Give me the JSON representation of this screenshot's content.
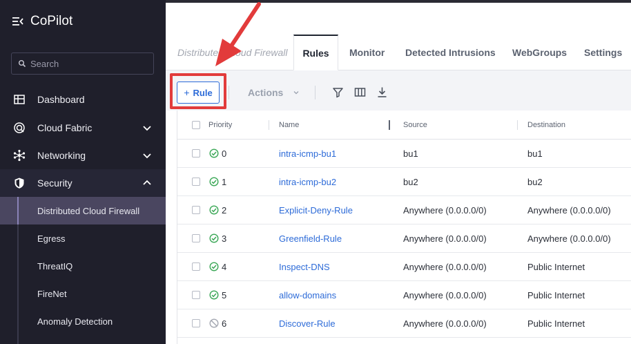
{
  "sidebar": {
    "brand": "CoPilot",
    "search_placeholder": "Search",
    "items": [
      {
        "label": "Dashboard",
        "icon": "dashboard-icon"
      },
      {
        "label": "Cloud Fabric",
        "icon": "cloud-fabric-icon",
        "expandable": true
      },
      {
        "label": "Networking",
        "icon": "networking-icon",
        "expandable": true
      },
      {
        "label": "Security",
        "icon": "shield-icon",
        "expanded": true
      }
    ],
    "security_subitems": [
      {
        "label": "Distributed Cloud Firewall",
        "selected": true
      },
      {
        "label": "Egress"
      },
      {
        "label": "ThreatIQ"
      },
      {
        "label": "FireNet"
      },
      {
        "label": "Anomaly Detection"
      }
    ]
  },
  "tabs": [
    {
      "label": "Distributed Cloud Firewall"
    },
    {
      "label": "Rules",
      "active": true
    },
    {
      "label": "Monitor"
    },
    {
      "label": "Detected Intrusions"
    },
    {
      "label": "WebGroups"
    },
    {
      "label": "Settings"
    }
  ],
  "toolbar": {
    "add_rule_label": "Rule",
    "actions_label": "Actions"
  },
  "table": {
    "headers": [
      "Priority",
      "Name",
      "Source",
      "Destination"
    ],
    "rows": [
      {
        "priority": "0",
        "name": "intra-icmp-bu1",
        "source": "bu1",
        "destination": "bu1",
        "status": "enabled"
      },
      {
        "priority": "1",
        "name": "intra-icmp-bu2",
        "source": "bu2",
        "destination": "bu2",
        "status": "enabled"
      },
      {
        "priority": "2",
        "name": "Explicit-Deny-Rule",
        "source": "Anywhere (0.0.0.0/0)",
        "destination": "Anywhere (0.0.0.0/0)",
        "status": "enabled"
      },
      {
        "priority": "3",
        "name": "Greenfield-Rule",
        "source": "Anywhere (0.0.0.0/0)",
        "destination": "Anywhere (0.0.0.0/0)",
        "status": "enabled"
      },
      {
        "priority": "4",
        "name": "Inspect-DNS",
        "source": "Anywhere (0.0.0.0/0)",
        "destination": "Public Internet",
        "status": "enabled"
      },
      {
        "priority": "5",
        "name": "allow-domains",
        "source": "Anywhere (0.0.0.0/0)",
        "destination": "Public Internet",
        "status": "enabled"
      },
      {
        "priority": "6",
        "name": "Discover-Rule",
        "source": "Anywhere (0.0.0.0/0)",
        "destination": "Public Internet",
        "status": "disabled"
      }
    ]
  },
  "colors": {
    "sidebar_bg": "#1f1f2b",
    "accent_blue": "#2d6bd8",
    "status_green": "#3aa756",
    "highlight_red": "#e23b3b"
  }
}
